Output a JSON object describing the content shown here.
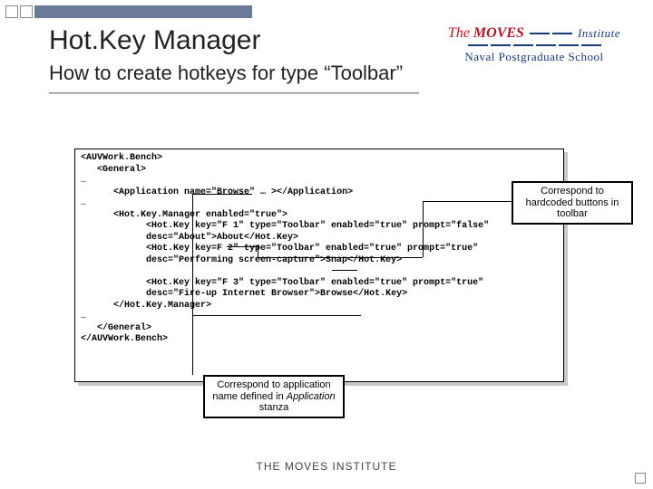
{
  "header": {
    "title": "Hot.Key Manager",
    "subtitle": "How to create hotkeys for type “Toolbar”"
  },
  "logo": {
    "line1_prefix": "The",
    "line1_main": "MOVES",
    "line1_suffix": "Institute",
    "line2": "Naval Postgraduate School"
  },
  "code": {
    "l1": "<AUVWork.Bench>",
    "l2": "   <General>",
    "l3": "…",
    "l4a": "      <Application name=\"",
    "l4b": "Browse",
    "l4c": "\" … ></Application>",
    "l5": "…",
    "l6": "      <Hot.Key.Manager enabled=\"true\">",
    "l7a": "            <Hot.Key key=\"F 1\" type=\"Toolbar\" enabled=\"true\" prompt=\"false\"",
    "l7b": "            desc=\"About\">",
    "l7c": "About",
    "l7d": "</Hot.Key>",
    "l8a": "            <Hot.Key key=F 2\" type=\"Toolbar\" enabled=\"true\" prompt=\"true\"",
    "l8b": "            desc=\"Performing screen-capture\">",
    "l8c": "Snap",
    "l8d": "</Hot.Key>",
    "l9": "",
    "l10a": "            <Hot.Key key=\"F 3\" type=\"Toolbar\" enabled=\"true\" prompt=\"true\"",
    "l10b": "            desc=\"Fire-up Internet Browser\">",
    "l10c": "Browse",
    "l10d": "</Hot.Key>",
    "l11": "      </Hot.Key.Manager>",
    "l12": "…",
    "l13": "   </General>",
    "l14": "</AUVWork.Bench>"
  },
  "callouts": {
    "c1": "Correspond to hardcoded buttons in toolbar",
    "c2a": "Correspond to application name defined in ",
    "c2b": "Application",
    "c2c": " stanza"
  },
  "footer": "THE MOVES INSTITUTE"
}
